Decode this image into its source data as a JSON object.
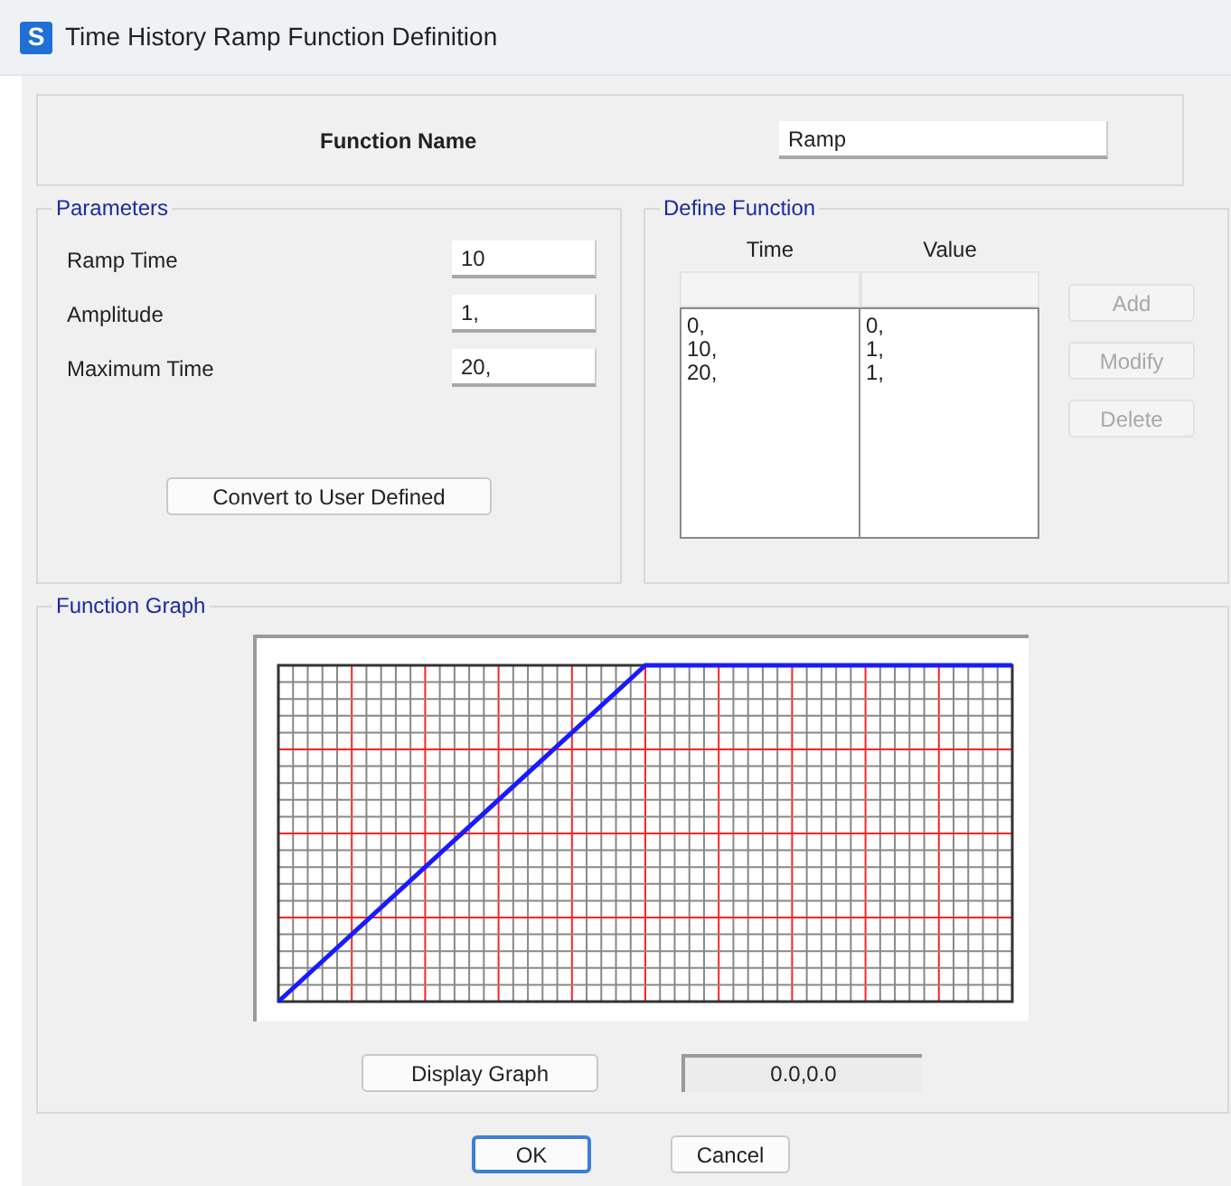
{
  "window": {
    "app_icon": "S",
    "title": "Time History Ramp Function Definition"
  },
  "function_name": {
    "label": "Function Name",
    "value": "Ramp"
  },
  "parameters": {
    "title": "Parameters",
    "fields": [
      {
        "label": "Ramp Time",
        "value": "10"
      },
      {
        "label": "Amplitude",
        "value": "1,"
      },
      {
        "label": "Maximum Time",
        "value": "20,"
      }
    ],
    "convert_button": "Convert to User Defined"
  },
  "define_function": {
    "title": "Define Function",
    "columns": [
      "Time",
      "Value"
    ],
    "rows": [
      [
        "0,",
        "0,"
      ],
      [
        "10,",
        "1,"
      ],
      [
        "20,",
        "1,"
      ]
    ],
    "buttons": [
      {
        "label": "Add",
        "disabled": true
      },
      {
        "label": "Modify",
        "disabled": true
      },
      {
        "label": "Delete",
        "disabled": true
      }
    ]
  },
  "function_graph": {
    "title": "Function Graph",
    "display_button": "Display Graph",
    "readout": "0.0,0.0"
  },
  "buttons": [
    {
      "label": "OK",
      "default": true
    },
    {
      "label": "Cancel",
      "default": false
    }
  ]
}
